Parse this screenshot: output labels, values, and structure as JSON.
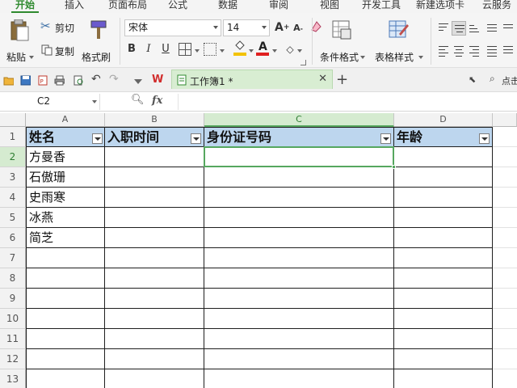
{
  "menu": {
    "tabs": [
      {
        "label": "开始",
        "active": true
      },
      {
        "label": "插入"
      },
      {
        "label": "页面布局"
      },
      {
        "label": "公式"
      },
      {
        "label": "数据"
      },
      {
        "label": "审阅"
      },
      {
        "label": "视图"
      },
      {
        "label": "开发工具"
      },
      {
        "label": "新建选项卡"
      },
      {
        "label": "云服务"
      }
    ]
  },
  "ribbon": {
    "paste_label": "粘贴",
    "cut_label": "剪切",
    "copy_label": "复制",
    "format_painter_label": "格式刷",
    "font_name": "宋体",
    "font_size": "14",
    "bold_label": "B",
    "italic_label": "I",
    "underline_label": "U",
    "conditional_format_label": "条件格式",
    "table_style_label": "表格样式",
    "font_color": "#e02020",
    "fill_color": "#f2c200"
  },
  "quickaccess": {
    "doc_tab_title": "工作簿1 *",
    "search_hint": "点击"
  },
  "formula_bar": {
    "name_box": "C2",
    "fx_label": "fx",
    "formula": ""
  },
  "sheet": {
    "selected_cell": "C2",
    "column_letters": [
      "A",
      "B",
      "C",
      "D"
    ],
    "row_numbers": [
      "1",
      "2",
      "3",
      "4",
      "5",
      "6",
      "7",
      "8",
      "9",
      "10",
      "11",
      "12",
      "13"
    ],
    "header_row": [
      "姓名",
      "入职时间",
      "身份证号码",
      "年龄"
    ],
    "names": [
      "方曼香",
      "石傲珊",
      "史雨寒",
      "冰燕",
      "简芝"
    ],
    "header_fill": "#bdd6ee",
    "selection_color": "#56a75f"
  }
}
